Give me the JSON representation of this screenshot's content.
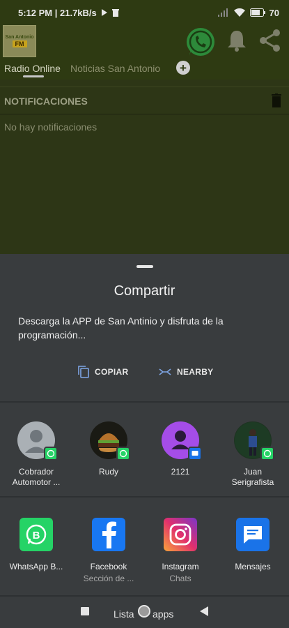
{
  "status_bar": {
    "time_speed": "5:12 PM | 21.7kB/s",
    "battery": "70"
  },
  "app": {
    "logo_line1": "San Antonio",
    "logo_line2": "FM"
  },
  "tabs": [
    {
      "label": "Radio Online",
      "active": true
    },
    {
      "label": "Noticias San Antonio",
      "active": false
    }
  ],
  "notifications": {
    "title": "NOTIFICACIONES",
    "empty_message": "No hay notificaciones"
  },
  "share_sheet": {
    "title": "Compartir",
    "text": "Descarga la APP de San Antinio y disfruta de la programación...",
    "copy_label": "COPIAR",
    "nearby_label": "NEARBY",
    "contacts": [
      {
        "name": "Cobrador Automotor ...",
        "badge": "whatsapp"
      },
      {
        "name": "Rudy",
        "badge": "whatsapp"
      },
      {
        "name": "2121",
        "badge": "messages"
      },
      {
        "name": "Juan Serigrafista",
        "badge": "whatsapp"
      }
    ],
    "apps": [
      {
        "label": "WhatsApp B...",
        "sub": ""
      },
      {
        "label": "Facebook",
        "sub": "Sección de ..."
      },
      {
        "label": "Instagram",
        "sub": "Chats"
      },
      {
        "label": "Mensajes",
        "sub": ""
      }
    ]
  },
  "nav_bar": {
    "home_label_left": "Lista",
    "home_label_right": "apps"
  },
  "colors": {
    "whatsapp_green": "#25d366",
    "facebook_blue": "#1877f2",
    "messages_blue": "#1a73e8",
    "sheet_bg": "#393c3e"
  }
}
